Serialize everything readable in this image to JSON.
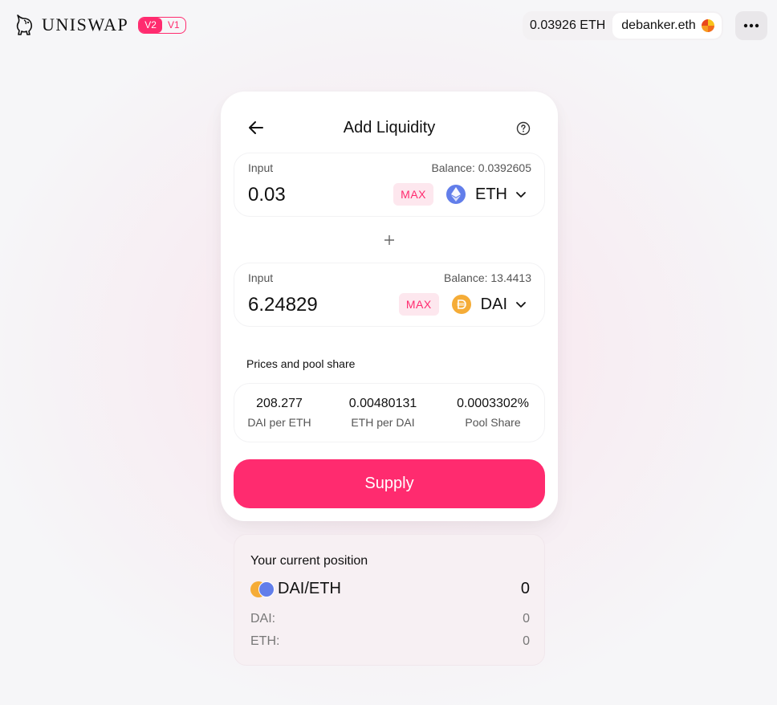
{
  "header": {
    "logo_text": "UNISWAP",
    "version_active": "V2",
    "version_inactive": "V1",
    "eth_balance": "0.03926 ETH",
    "account_name": "debanker.eth",
    "menu_icon": "more-horizontal-icon"
  },
  "card": {
    "title": "Add Liquidity",
    "back_icon": "arrow-left-icon",
    "help_icon": "question-circle-icon",
    "input_a": {
      "label": "Input",
      "balance": "Balance: 0.0392605",
      "value": "0.03",
      "max_label": "MAX",
      "token": "ETH"
    },
    "input_b": {
      "label": "Input",
      "balance": "Balance: 13.4413",
      "value": "6.24829",
      "max_label": "MAX",
      "token": "DAI"
    },
    "prices": {
      "title": "Prices and pool share",
      "items": [
        {
          "value": "208.277",
          "label": "DAI per ETH"
        },
        {
          "value": "0.00480131",
          "label": "ETH per DAI"
        },
        {
          "value": "0.0003302%",
          "label": "Pool Share"
        }
      ]
    },
    "supply_label": "Supply"
  },
  "position": {
    "title": "Your current position",
    "pair": "DAI/ETH",
    "total": "0",
    "rows": [
      {
        "label": "DAI:",
        "value": "0"
      },
      {
        "label": "ETH:",
        "value": "0"
      }
    ]
  },
  "colors": {
    "accent": "#ff2b6f",
    "eth": "#627eea",
    "dai": "#f5ac37"
  }
}
